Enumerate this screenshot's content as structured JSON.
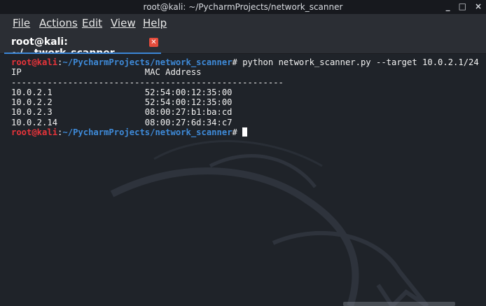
{
  "window": {
    "title": "root@kali: ~/PycharmProjects/network_scanner",
    "controls": {
      "minimize": "_",
      "maximize": "□",
      "close": "×"
    }
  },
  "menu": {
    "items": [
      {
        "label": "File"
      },
      {
        "label": "Actions"
      },
      {
        "label": "Edit"
      },
      {
        "label": "View"
      },
      {
        "label": "Help"
      }
    ]
  },
  "tab": {
    "label": "root@kali: ~/...twork_scanner",
    "close_icon": "close-icon"
  },
  "terminal": {
    "prompt": {
      "user_host": "root@kali",
      "colon": ":",
      "path": "~/PycharmProjects/network_scanner",
      "hash": "#"
    },
    "command": " python network_scanner.py --target 10.0.2.1/24",
    "header": {
      "ip": "IP",
      "mac": "MAC Address"
    },
    "separator": "-----------------------------------------------------",
    "rows": [
      {
        "ip": "10.0.2.1",
        "mac": "52:54:00:12:35:00"
      },
      {
        "ip": "10.0.2.2",
        "mac": "52:54:00:12:35:00"
      },
      {
        "ip": "10.0.2.3",
        "mac": "08:00:27:b1:ba:cd"
      },
      {
        "ip": "10.0.2.14",
        "mac": "08:00:27:6d:34:c7"
      }
    ]
  },
  "colors": {
    "prompt_user": "#e8343a",
    "prompt_path": "#3e8ad8",
    "background": "#1f2329",
    "tab_underline": "#3b86d6",
    "tab_close": "#e44c3c"
  }
}
